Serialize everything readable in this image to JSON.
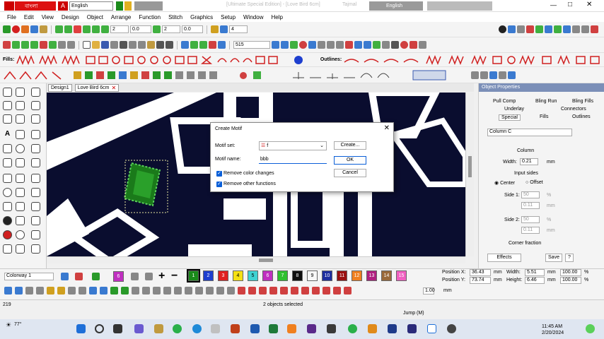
{
  "titlebar": {
    "lang_badge": "বাংলা",
    "lang_select": "English",
    "title": "[Ultimate Special Edition] - [Love Bird 6cm]",
    "title_right": "Tajmal",
    "ime_label": "English"
  },
  "menu": [
    "File",
    "Edit",
    "View",
    "Design",
    "Object",
    "Arrange",
    "Function",
    "Stitch",
    "Graphics",
    "Setup",
    "Window",
    "Help"
  ],
  "toolbar1": {
    "field_a": "2",
    "field_b": "0.0",
    "field_c": "2",
    "field_d": "0.0",
    "field_e": "4"
  },
  "toolbar2": {
    "stitch_value": "515"
  },
  "toolbar3": {
    "fills_label": "Fills:",
    "outlines_label": "Outlines:"
  },
  "tabs": [
    {
      "label": "Design1"
    },
    {
      "label": "Love Bird 6cm"
    }
  ],
  "dialog": {
    "title": "Create Motif",
    "motif_set_label": "Motif set:",
    "motif_set_value": "f",
    "create_button": "Create...",
    "motif_name_label": "Motif name:",
    "motif_name_value": "bbb",
    "ok_button": "OK",
    "cancel_button": "Cancel",
    "remove_color_label": "Remove color changes",
    "remove_functions_label": "Remove other functions",
    "remove_color_checked": true,
    "remove_functions_checked": true
  },
  "props": {
    "header": "Object Properties",
    "tabs_row1": [
      "Pull Comp",
      "Bling Run",
      "Bling Fills"
    ],
    "tabs_row2": [
      "Underlay",
      "Connectors"
    ],
    "tabs_row3": [
      "Special",
      "Fills",
      "Outlines"
    ],
    "stitch_type": "Column C",
    "section_column": "Column",
    "width_label": "Width:",
    "width_value": "0.21",
    "width_unit": "mm",
    "input_sides_label": "Input sides",
    "center_label": "Center",
    "offset_label": "Offset",
    "side1_label": "Side 1:",
    "side1_value": "50",
    "side1_unit": "%",
    "side1_mm": "0.11",
    "side1_mm_unit": "mm",
    "side2_label": "Side 2:",
    "side2_value": "50",
    "side2_unit": "%",
    "side2_mm": "0.11",
    "side2_mm_unit": "mm",
    "corner_fraction": "Corner fraction",
    "effects_button": "Effects",
    "save_button": "Save",
    "help_button": "?"
  },
  "bottom": {
    "colorway": "Colorway 1",
    "swatches": [
      {
        "num": "1",
        "color": "#1a8a1a"
      },
      {
        "num": "2",
        "color": "#1e3fcf"
      },
      {
        "num": "3",
        "color": "#e02020"
      },
      {
        "num": "4",
        "color": "#f5e014"
      },
      {
        "num": "5",
        "color": "#3fd2d2"
      },
      {
        "num": "6",
        "color": "#c030c0"
      },
      {
        "num": "7",
        "color": "#30c030"
      },
      {
        "num": "8",
        "color": "#101010"
      },
      {
        "num": "9",
        "color": "#f8f8f8"
      },
      {
        "num": "10",
        "color": "#1e2f9f"
      },
      {
        "num": "11",
        "color": "#9a1010"
      },
      {
        "num": "12",
        "color": "#f08020"
      },
      {
        "num": "13",
        "color": "#b02080"
      },
      {
        "num": "14",
        "color": "#9a6a3a"
      },
      {
        "num": "15",
        "color": "#f060c0"
      }
    ],
    "first_swatch": "6",
    "pos_x_label": "Position X:",
    "pos_x_value": "36.43",
    "pos_x_unit": "mm",
    "pos_y_label": "Position Y:",
    "pos_y_value": "73.74",
    "pos_y_unit": "mm",
    "width_label": "Width:",
    "width_value": "5.51",
    "width_unit": "mm",
    "height_label": "Height:",
    "height_value": "6.46",
    "height_unit": "mm",
    "scale_w": "100.00",
    "scale_h": "100.00",
    "pct1": "%",
    "pct2": "%",
    "zoom_value": "1.00",
    "zoom_unit": "mm"
  },
  "status": {
    "stitch_count": "219",
    "selection": "2 objects selected",
    "jump": "Jump (M)"
  },
  "taskbar": {
    "weather": "77°",
    "time": "11:45 AM",
    "date": "2/20/2024"
  }
}
